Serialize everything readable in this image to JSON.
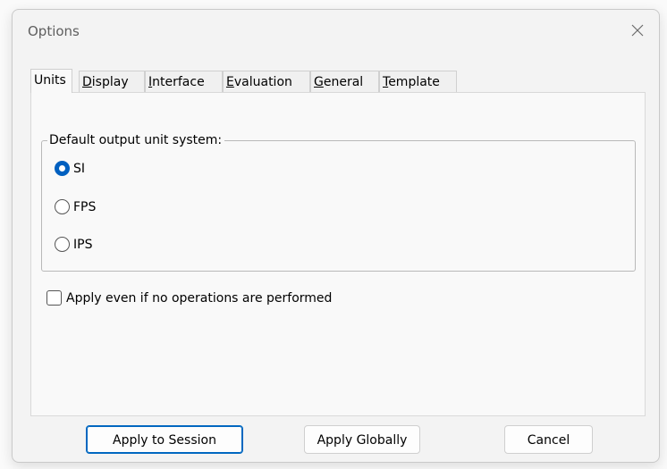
{
  "window": {
    "title": "Options",
    "close_symbol": "×"
  },
  "tabs": [
    {
      "label": "Units",
      "active": true
    },
    {
      "label": "Display",
      "mnemonic": "D",
      "rest": "isplay"
    },
    {
      "label": "Interface",
      "mnemonic": "I",
      "rest": "nterface"
    },
    {
      "label": "Evaluation",
      "mnemonic": "E",
      "rest": "valuation"
    },
    {
      "label": "General",
      "mnemonic": "G",
      "rest": "eneral"
    },
    {
      "label": "Template",
      "mnemonic": "T",
      "rest": "emplate"
    }
  ],
  "units": {
    "group_label": "Default output unit system:",
    "options": [
      {
        "label": "SI",
        "checked": true
      },
      {
        "label": "FPS",
        "checked": false
      },
      {
        "label": "IPS",
        "checked": false
      }
    ],
    "apply_checkbox": {
      "label": "Apply even if no operations are performed",
      "checked": false
    }
  },
  "buttons": {
    "apply_session": "Apply to Session",
    "apply_globally": "Apply Globally",
    "cancel": "Cancel"
  },
  "colors": {
    "accent": "#0067c0",
    "dialog_bg": "#f3f3f3",
    "panel_bg": "#f9f9f9"
  }
}
